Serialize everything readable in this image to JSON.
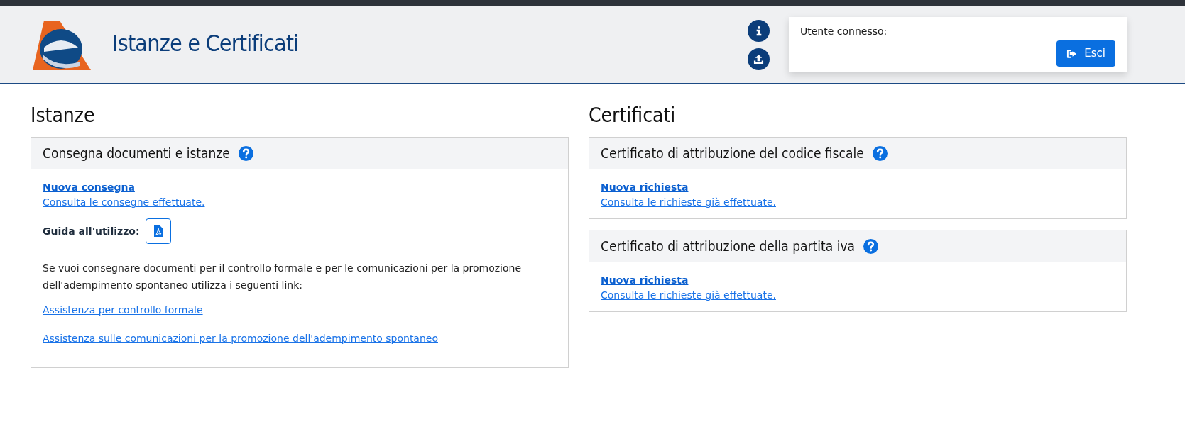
{
  "header": {
    "title": "Istanze e Certificati",
    "user_box": {
      "label": "Utente connesso:",
      "logout_button": "Esci"
    }
  },
  "columns": [
    {
      "heading": "Istanze",
      "cards": [
        {
          "title": "Consegna documenti e istanze",
          "items": [
            {
              "kind": "primary_link",
              "text": "Nuova consegna"
            },
            {
              "kind": "link",
              "text": "Consulta le consegne effettuate."
            },
            {
              "kind": "guide",
              "text": "Guida all'utilizzo:"
            },
            {
              "kind": "paragraph",
              "text": "Se vuoi consegnare documenti per il controllo formale e per le comunicazioni per la promozione dell'adempimento spontaneo utilizza i seguenti link:"
            },
            {
              "kind": "spaced_link",
              "text": "Assistenza per controllo formale"
            },
            {
              "kind": "spaced_link",
              "text": "Assistenza sulle comunicazioni per la promozione dell'adempimento spontaneo"
            }
          ]
        }
      ]
    },
    {
      "heading": "Certificati",
      "cards": [
        {
          "title": "Certificato di attribuzione del codice fiscale",
          "items": [
            {
              "kind": "primary_link",
              "text": "Nuova richiesta"
            },
            {
              "kind": "link",
              "text": "Consulta le richieste già effettuate."
            }
          ]
        },
        {
          "title": "Certificato di attribuzione della partita iva",
          "items": [
            {
              "kind": "primary_link",
              "text": "Nuova richiesta"
            },
            {
              "kind": "link",
              "text": "Consulta le richieste già effettuate."
            }
          ]
        }
      ]
    }
  ]
}
